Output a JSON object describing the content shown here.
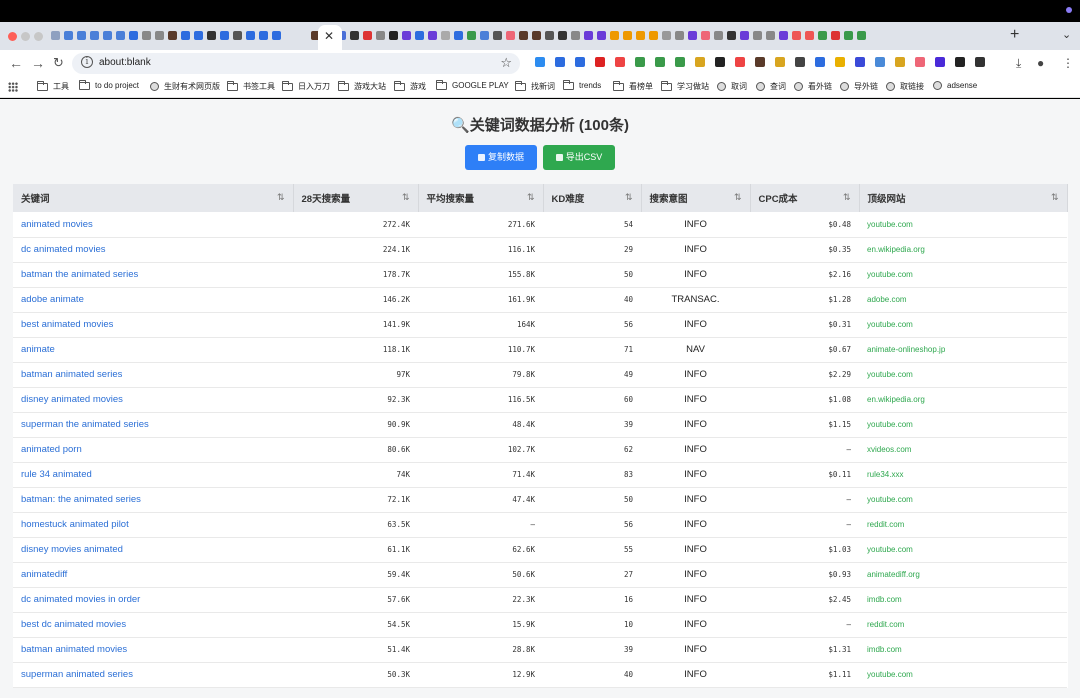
{
  "browser": {
    "url": "about:blank",
    "bookmarks": [
      "工具",
      "to do project",
      "生财有术网页版",
      "书签工具",
      "日入万刀",
      "游戏大站",
      "游戏",
      "GOOGLE PLAY",
      "找新词",
      "trends",
      "看榜单",
      "学习做站",
      "取词",
      "查词",
      "看外链",
      "导外链",
      "取链接",
      "adsense"
    ]
  },
  "page": {
    "title_icon": "🔍",
    "title": "关键词数据分析 (100条)",
    "copy_label": "复制数据",
    "export_label": "导出CSV"
  },
  "table": {
    "columns": [
      "关键词",
      "28天搜索量",
      "平均搜索量",
      "KD难度",
      "搜索意图",
      "CPC成本",
      "顶级网站"
    ],
    "sort_icon": "⇅",
    "rows": [
      {
        "keyword": "animated movies",
        "v28": "272.4K",
        "avg": "271.6K",
        "kd": "54",
        "intent": "INFO",
        "cpc": "$0.48",
        "site": "youtube.com"
      },
      {
        "keyword": "dc animated movies",
        "v28": "224.1K",
        "avg": "116.1K",
        "kd": "29",
        "intent": "INFO",
        "cpc": "$0.35",
        "site": "en.wikipedia.org"
      },
      {
        "keyword": "batman the animated series",
        "v28": "178.7K",
        "avg": "155.8K",
        "kd": "50",
        "intent": "INFO",
        "cpc": "$2.16",
        "site": "youtube.com"
      },
      {
        "keyword": "adobe animate",
        "v28": "146.2K",
        "avg": "161.9K",
        "kd": "40",
        "intent": "TRANSAC.",
        "cpc": "$1.28",
        "site": "adobe.com"
      },
      {
        "keyword": "best animated movies",
        "v28": "141.9K",
        "avg": "164K",
        "kd": "56",
        "intent": "INFO",
        "cpc": "$0.31",
        "site": "youtube.com"
      },
      {
        "keyword": "animate",
        "v28": "118.1K",
        "avg": "110.7K",
        "kd": "71",
        "intent": "NAV",
        "cpc": "$0.67",
        "site": "animate-onlineshop.jp"
      },
      {
        "keyword": "batman animated series",
        "v28": "97K",
        "avg": "79.8K",
        "kd": "49",
        "intent": "INFO",
        "cpc": "$2.29",
        "site": "youtube.com"
      },
      {
        "keyword": "disney animated movies",
        "v28": "92.3K",
        "avg": "116.5K",
        "kd": "60",
        "intent": "INFO",
        "cpc": "$1.08",
        "site": "en.wikipedia.org"
      },
      {
        "keyword": "superman the animated series",
        "v28": "90.9K",
        "avg": "48.4K",
        "kd": "39",
        "intent": "INFO",
        "cpc": "$1.15",
        "site": "youtube.com"
      },
      {
        "keyword": "animated porn",
        "v28": "80.6K",
        "avg": "102.7K",
        "kd": "62",
        "intent": "INFO",
        "cpc": "–",
        "site": "xvideos.com"
      },
      {
        "keyword": "rule 34 animated",
        "v28": "74K",
        "avg": "71.4K",
        "kd": "83",
        "intent": "INFO",
        "cpc": "$0.11",
        "site": "rule34.xxx"
      },
      {
        "keyword": "batman: the animated series",
        "v28": "72.1K",
        "avg": "47.4K",
        "kd": "50",
        "intent": "INFO",
        "cpc": "–",
        "site": "youtube.com"
      },
      {
        "keyword": "homestuck animated pilot",
        "v28": "63.5K",
        "avg": "–",
        "kd": "56",
        "intent": "INFO",
        "cpc": "–",
        "site": "reddit.com"
      },
      {
        "keyword": "disney movies animated",
        "v28": "61.1K",
        "avg": "62.6K",
        "kd": "55",
        "intent": "INFO",
        "cpc": "$1.03",
        "site": "youtube.com"
      },
      {
        "keyword": "animatediff",
        "v28": "59.4K",
        "avg": "50.6K",
        "kd": "27",
        "intent": "INFO",
        "cpc": "$0.93",
        "site": "animatediff.org"
      },
      {
        "keyword": "dc animated movies in order",
        "v28": "57.6K",
        "avg": "22.3K",
        "kd": "16",
        "intent": "INFO",
        "cpc": "$2.45",
        "site": "imdb.com"
      },
      {
        "keyword": "best dc animated movies",
        "v28": "54.5K",
        "avg": "15.9K",
        "kd": "10",
        "intent": "INFO",
        "cpc": "–",
        "site": "reddit.com"
      },
      {
        "keyword": "batman animated movies",
        "v28": "51.4K",
        "avg": "28.8K",
        "kd": "39",
        "intent": "INFO",
        "cpc": "$1.31",
        "site": "imdb.com"
      },
      {
        "keyword": "superman animated series",
        "v28": "50.3K",
        "avg": "12.9K",
        "kd": "40",
        "intent": "INFO",
        "cpc": "$1.11",
        "site": "youtube.com"
      }
    ]
  },
  "colors": {
    "link_blue": "#2b6fd6",
    "site_green": "#2fa84f",
    "copy_button": "#2e7ff7",
    "export_button": "#2fa84f"
  }
}
